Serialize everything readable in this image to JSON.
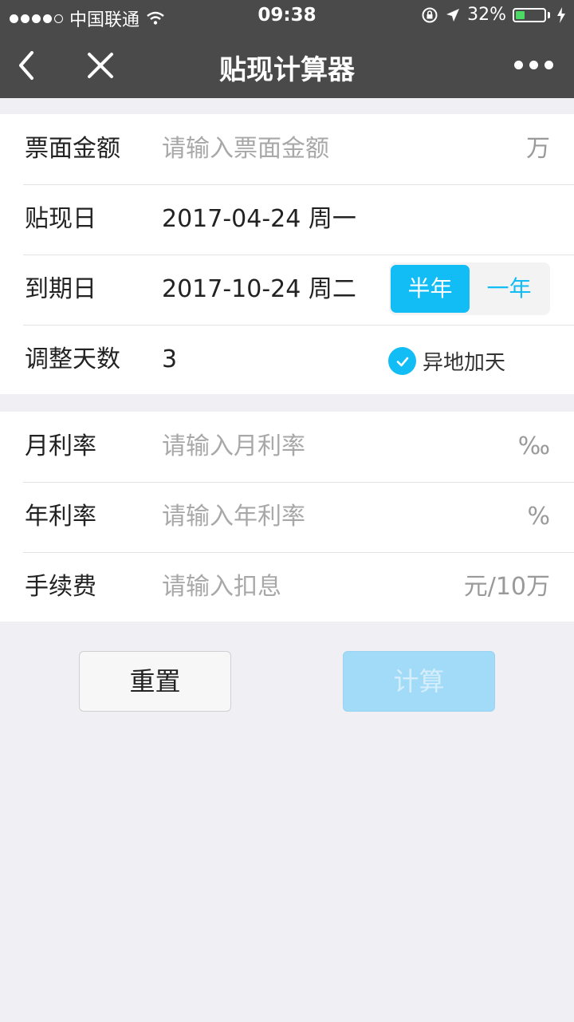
{
  "status_bar": {
    "carrier": "中国联通",
    "time": "09:38",
    "battery_percent": "32%",
    "battery_level": 0.32
  },
  "nav": {
    "title": "贴现计算器"
  },
  "form": {
    "face_amount": {
      "label": "票面金额",
      "placeholder": "请输入票面金额",
      "unit": "万"
    },
    "discount_date": {
      "label": "贴现日",
      "value": "2017-04-24 周一"
    },
    "due_date": {
      "label": "到期日",
      "value": "2017-10-24 周二",
      "options": [
        "半年",
        "一年"
      ],
      "selected": "半年"
    },
    "adjust_days": {
      "label": "调整天数",
      "value": "3",
      "checkbox_label": "异地加天",
      "checked": true
    },
    "monthly_rate": {
      "label": "月利率",
      "placeholder": "请输入月利率",
      "unit": "‰"
    },
    "annual_rate": {
      "label": "年利率",
      "placeholder": "请输入年利率",
      "unit": "%"
    },
    "fee": {
      "label": "手续费",
      "placeholder": "请输入扣息",
      "unit": "元/10万"
    }
  },
  "buttons": {
    "reset": "重置",
    "calculate": "计算"
  },
  "colors": {
    "accent": "#12bcf4",
    "header_bg": "#4a4a4a",
    "page_bg": "#efeff4",
    "battery": "#4cd964"
  }
}
